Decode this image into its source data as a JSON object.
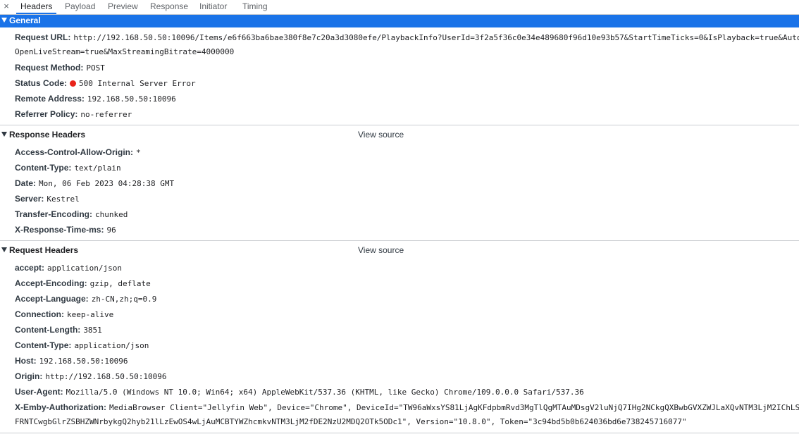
{
  "tabs": {
    "close": "×",
    "items": [
      "Headers",
      "Payload",
      "Preview",
      "Response",
      "Initiator",
      "Timing"
    ],
    "active": "Headers"
  },
  "general": {
    "title": "General",
    "request_url_label": "Request URL:",
    "request_url_line1": "http://192.168.50.50:10096/Items/e6f663ba6bae380f8e7c20a3d3080efe/PlaybackInfo?UserId=3f2a5f36c0e34e489680f96d10e93b57&StartTimeTicks=0&IsPlayback=true&Auto",
    "request_url_line2": "OpenLiveStream=true&MaxStreamingBitrate=4000000",
    "request_method_label": "Request Method:",
    "request_method": "POST",
    "status_code_label": "Status Code:",
    "status_code": "500 Internal Server Error",
    "status_color": "#e8231a",
    "remote_address_label": "Remote Address:",
    "remote_address": "192.168.50.50:10096",
    "referrer_policy_label": "Referrer Policy:",
    "referrer_policy": "no-referrer"
  },
  "response_headers": {
    "title": "Response Headers",
    "view_source": "View source",
    "items": [
      {
        "k": "Access-Control-Allow-Origin:",
        "v": "*"
      },
      {
        "k": "Content-Type:",
        "v": "text/plain"
      },
      {
        "k": "Date:",
        "v": "Mon, 06 Feb 2023 04:28:38 GMT"
      },
      {
        "k": "Server:",
        "v": "Kestrel"
      },
      {
        "k": "Transfer-Encoding:",
        "v": "chunked"
      },
      {
        "k": "X-Response-Time-ms:",
        "v": "96"
      }
    ]
  },
  "request_headers": {
    "title": "Request Headers",
    "view_source": "View source",
    "items": [
      {
        "k": "accept:",
        "v": "application/json"
      },
      {
        "k": "Accept-Encoding:",
        "v": "gzip, deflate"
      },
      {
        "k": "Accept-Language:",
        "v": "zh-CN,zh;q=0.9"
      },
      {
        "k": "Connection:",
        "v": "keep-alive"
      },
      {
        "k": "Content-Length:",
        "v": "3851"
      },
      {
        "k": "Content-Type:",
        "v": "application/json"
      },
      {
        "k": "Host:",
        "v": "192.168.50.50:10096"
      },
      {
        "k": "Origin:",
        "v": "http://192.168.50.50:10096"
      },
      {
        "k": "User-Agent:",
        "v": "Mozilla/5.0 (Windows NT 10.0; Win64; x64) AppleWebKit/537.36 (KHTML, like Gecko) Chrome/109.0.0.0 Safari/537.36"
      },
      {
        "k": "X-Emby-Authorization:",
        "v": "MediaBrowser Client=\"Jellyfin Web\", Device=\"Chrome\", DeviceId=\"TW96aWxsYS81LjAgKFdpbmRvd3MgTlQgMTAuMDsgV2luNjQ7IHg2NCkgQXBwbGVXZWJLaXQvNTM3LjM2IChLS"
      }
    ],
    "auth_continuation": "FRNTCwgbGlrZSBHZWNrbykgQ2hyb21lLzEwOS4wLjAuMCBTYWZhcmkvNTM3LjM2fDE2NzU2MDQ2OTk5ODc1\", Version=\"10.8.0\", Token=\"3c94bd5b0b624036bd6e738245716077\""
  }
}
